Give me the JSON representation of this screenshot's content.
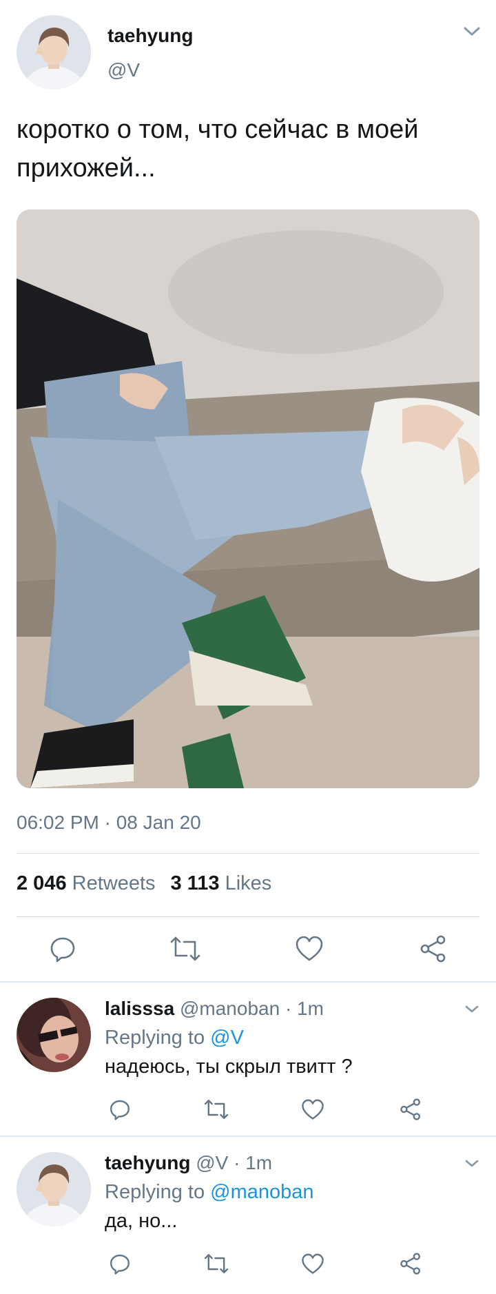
{
  "tweet": {
    "author_name": "taehyung",
    "author_handle": "@V",
    "text": "коротко о том, что сейчас в моей прихожей...",
    "timestamp": "06:02 PM · 08 Jan 20",
    "retweets_count": "2 046",
    "retweets_label": "Retweets",
    "likes_count": "3 113",
    "likes_label": "Likes"
  },
  "replies": [
    {
      "name": "lalisssa",
      "meta": "@manoban · 1m",
      "replying_label": "Replying to",
      "replying_to": "@V",
      "text": "надеюсь, ты скрыл твитт ?"
    },
    {
      "name": "taehyung",
      "meta": "@V · 1m",
      "replying_label": "Replying to",
      "replying_to": "@manoban",
      "text": "да, но..."
    }
  ],
  "icons": {
    "menu": "chevron-down-icon",
    "reply": "reply-icon",
    "retweet": "retweet-icon",
    "like": "heart-icon",
    "share": "share-icon"
  },
  "colors": {
    "text": "#14171a",
    "secondary": "#657786",
    "mention": "#1b95e0",
    "divider": "#e1e8ed"
  }
}
